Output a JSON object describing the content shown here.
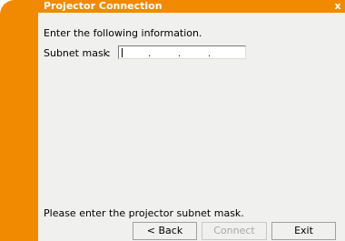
{
  "window": {
    "title": "Projector Connection",
    "close_glyph": "x"
  },
  "form": {
    "instruction": "Enter the following information.",
    "subnet_label": "Subnet mask",
    "colon": ":",
    "subnet_value": "",
    "separator": "."
  },
  "footer": {
    "status": "Please enter the projector subnet mask."
  },
  "buttons": {
    "back": "< Back",
    "connect": "Connect",
    "exit": "Exit"
  },
  "colors": {
    "accent": "#f18a00",
    "panel": "#f0f0ef"
  }
}
